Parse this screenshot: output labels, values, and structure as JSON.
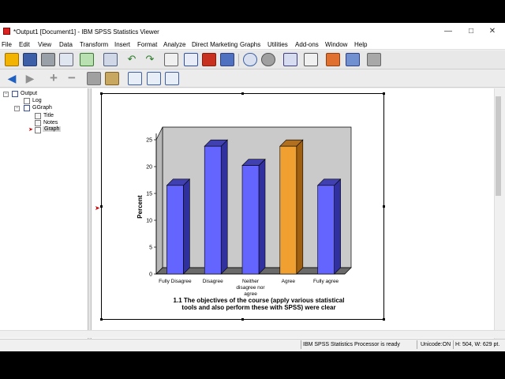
{
  "window": {
    "title": "*Output1 [Document1] - IBM SPSS Statistics Viewer",
    "controls": [
      "—",
      "□",
      "✕"
    ]
  },
  "menu": [
    "File",
    "Edit",
    "View",
    "Data",
    "Transform",
    "Insert",
    "Format",
    "Analyze",
    "Direct Marketing",
    "Graphs",
    "Utilities",
    "Add-ons",
    "Window",
    "Help"
  ],
  "toolbar1_icons": [
    "open-icon",
    "save-icon",
    "print-icon",
    "print-preview-icon",
    "export-icon",
    "recall-dialog-icon",
    "undo-icon",
    "redo-icon",
    "goto-data-icon",
    "goto-case-icon",
    "goto-variable-icon",
    "variables-icon",
    "split-file-icon",
    "weight-cases-icon",
    "select-cases-icon",
    "value-labels-icon",
    "use-sets-icon",
    "show-all-variables-icon",
    "spelling-icon"
  ],
  "toolbar2_icons": [
    "back-icon",
    "forward-icon",
    "expand-icon",
    "collapse-icon",
    "show-icon",
    "hide-icon",
    "insert-heading-icon",
    "insert-title-icon",
    "insert-text-icon"
  ],
  "navigator": {
    "items": [
      {
        "label": "Output",
        "level": 0,
        "icon": "output-book-icon"
      },
      {
        "label": "Log",
        "level": 1,
        "icon": "log-icon"
      },
      {
        "label": "GGraph",
        "level": 1,
        "icon": "ggraph-book-icon"
      },
      {
        "label": "Title",
        "level": 2,
        "icon": "title-icon"
      },
      {
        "label": "Notes",
        "level": 2,
        "icon": "notes-icon"
      },
      {
        "label": "Graph",
        "level": 2,
        "icon": "graph-icon",
        "selected": true
      }
    ]
  },
  "status": {
    "processor": "IBM SPSS Statistics Processor is ready",
    "unicode": "Unicode:ON",
    "dims": "H: 504, W: 629 pt."
  },
  "chart_data": {
    "type": "bar",
    "categories": [
      "Fully Disagree",
      "Disagree",
      "Neither disagree nor agree",
      "Agree",
      "Fully agree"
    ],
    "category_lines": [
      [
        "Fully Disagree"
      ],
      [
        "Disagree"
      ],
      [
        "Neither",
        "disagree nor",
        "agree"
      ],
      [
        "Agree"
      ],
      [
        "Fully agree"
      ]
    ],
    "values": [
      16.5,
      23.8,
      20.2,
      23.8,
      16.5
    ],
    "highlight_index": 3,
    "ylabel": "Percent",
    "xlabel": "",
    "ylim": [
      0,
      25
    ],
    "yticks": [
      0,
      5,
      10,
      15,
      20,
      25
    ],
    "title_lines": [
      "1.1 The objectives of the course (apply various statistical",
      "tools and also perform these with SPSS) were clear"
    ],
    "colors": {
      "bar": "#6464ff",
      "bar_top": "#4040b0",
      "bar_side": "#3030a0",
      "highlight": "#f0a030",
      "highlight_top": "#b07020",
      "highlight_side": "#a06010",
      "wall": "#cacaca",
      "floor": "#6a6a6a"
    }
  }
}
